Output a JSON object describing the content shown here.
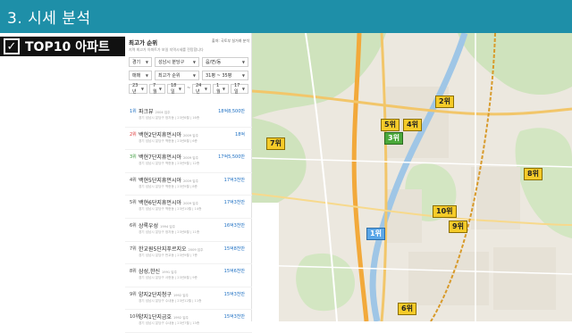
{
  "slide": {
    "title": "3. 시세 분석",
    "badge": "TOP10 아파트",
    "badge_check": "✓"
  },
  "panel": {
    "title": "최고가 순위",
    "source": "출처: 국토부 실거래 분석",
    "description": "지역 최고가 아파트가 보일 지역시세를 전망합니다",
    "filters_row1": [
      "경기",
      "성남시 분당구",
      "읍/면/동"
    ],
    "filters_row2": [
      "매매",
      "최고가 순위",
      "31평 ~ 35평"
    ],
    "filters_row3": [
      "23년",
      "7월",
      "18일",
      "24년",
      "1월",
      "17일"
    ],
    "filters_row3_separator": "~",
    "items": [
      {
        "rank": "1위",
        "name": "파크뷰",
        "year": "2004 입주",
        "price": "18억8,500만",
        "sub": "경기 성남시 분당구 정자동 | 23년6월 | 16층"
      },
      {
        "rank": "2위",
        "name": "백현2단지휴먼시아",
        "year": "2009 입주",
        "price": "18억",
        "sub": "경기 성남시 분당구 백현동 | 23년8월 | 6층"
      },
      {
        "rank": "3위",
        "name": "백현7단지휴먼시아",
        "year": "2009 입주",
        "price": "17억5,500만",
        "sub": "경기 성남시 분당구 백현동 | 23년9월 | 12층"
      },
      {
        "rank": "4위",
        "name": "백현5단지휴먼시아",
        "year": "2009 입주",
        "price": "17억3천만",
        "sub": "경기 성남시 분당구 백현동 | 23년9월 | 8층"
      },
      {
        "rank": "5위",
        "name": "백현6단지휴먼시아",
        "year": "2009 입주",
        "price": "17억3천만",
        "sub": "경기 성남시 분당구 백현동 | 23년10월 | 14층"
      },
      {
        "rank": "6위",
        "name": "상록우성",
        "year": "1994 입주",
        "price": "16억3천만",
        "sub": "경기 성남시 분당구 정자동 | 23년8월 | 11층"
      },
      {
        "rank": "7위",
        "name": "한교원5단지푸르지오",
        "year": "2009 입주",
        "price": "15억8천만",
        "sub": "경기 성남시 분당구 판교동 | 23년9월 | 7층"
      },
      {
        "rank": "8위",
        "name": "삼성,한신",
        "year": "1991 입주",
        "price": "15억6천만",
        "sub": "경기 성남시 분당구 서현동 | 23년8월 | 9층"
      },
      {
        "rank": "9위",
        "name": "양지2단지청구",
        "year": "1992 입주",
        "price": "15억3천만",
        "sub": "경기 성남시 분당구 수내동 | 23년12월 | 11층"
      },
      {
        "rank": "10위",
        "name": "양지1단지금호",
        "year": "1992 입주",
        "price": "15억3천만",
        "sub": "경기 성남시 분당구 수내동 | 23년7월 | 13층"
      }
    ]
  },
  "map": {
    "markers": [
      "1위",
      "2위",
      "3위",
      "4위",
      "5위",
      "6위",
      "7위",
      "8위",
      "9위",
      "10위"
    ]
  }
}
